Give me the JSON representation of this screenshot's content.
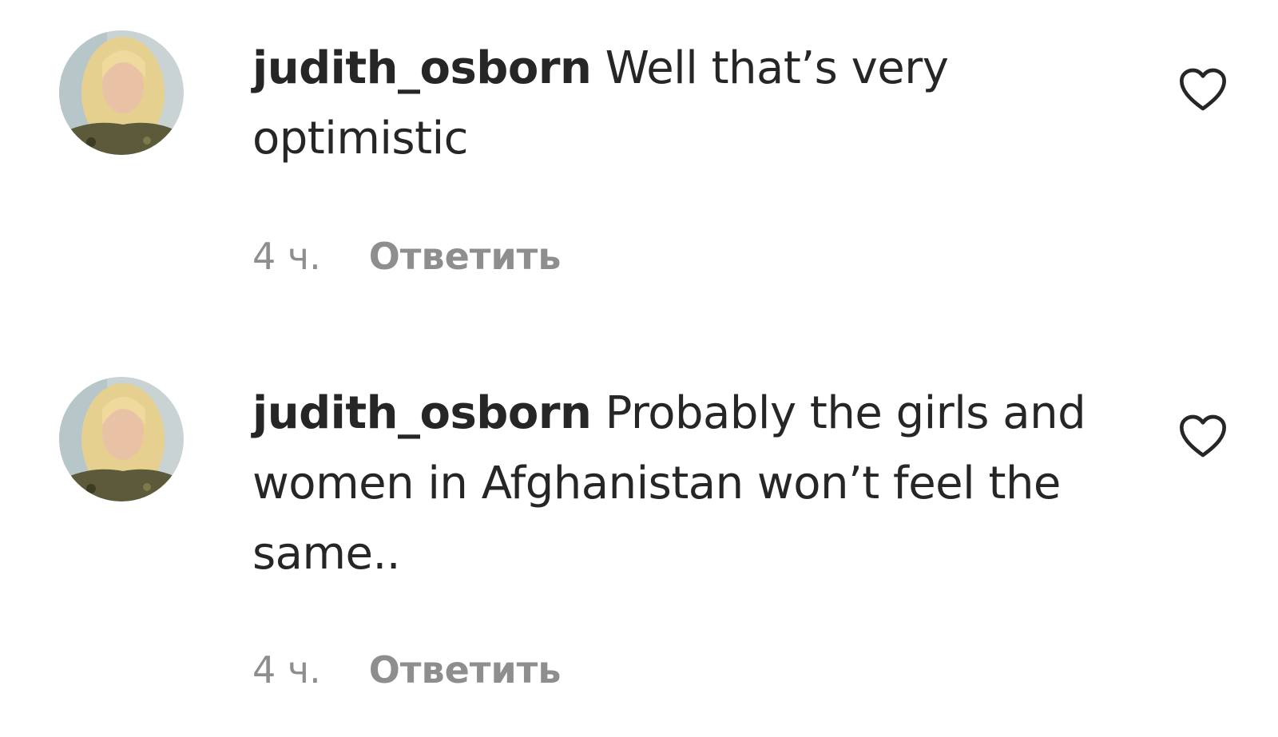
{
  "comments": [
    {
      "username": "judith_osborn",
      "text": "Well that’s very optimistic",
      "time": "4 ч.",
      "reply_label": "Ответить",
      "like_icon": "heart-outline-icon"
    },
    {
      "username": "judith_osborn",
      "text": "Probably the girls and women in Afghanistan won’t feel the same..",
      "time": "4 ч.",
      "reply_label": "Ответить",
      "like_icon": "heart-outline-icon"
    }
  ],
  "colors": {
    "text_primary": "#262626",
    "text_secondary": "#8e8e8e",
    "background": "#ffffff"
  }
}
